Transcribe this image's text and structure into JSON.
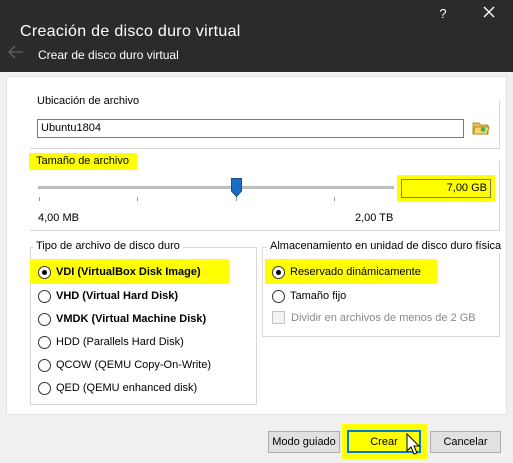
{
  "window": {
    "title": "Creación de disco duro virtual",
    "subtitle": "Crear de disco duro virtual",
    "help_label": "?"
  },
  "file_location": {
    "label": "Ubicación de archivo",
    "value": "Ubuntu1804",
    "browse_icon": "folder-icon"
  },
  "file_size": {
    "label": "Tamaño de archivo",
    "value": "7,00 GB",
    "min_label": "4,00 MB",
    "max_label": "2,00 TB",
    "slider_fraction": 0.56
  },
  "disk_type": {
    "label": "Tipo de archivo de disco duro",
    "options": [
      {
        "label": "VDI (VirtualBox Disk Image)",
        "selected": true
      },
      {
        "label": "VHD (Virtual Hard Disk)",
        "selected": false
      },
      {
        "label": "VMDK (Virtual Machine Disk)",
        "selected": false
      },
      {
        "label": "HDD (Parallels Hard Disk)",
        "selected": false
      },
      {
        "label": "QCOW (QEMU Copy-On-Write)",
        "selected": false
      },
      {
        "label": "QED (QEMU enhanced disk)",
        "selected": false
      }
    ]
  },
  "storage": {
    "label": "Almacenamiento en unidad de disco duro física",
    "options": [
      {
        "label": "Reservado dinámicamente",
        "selected": true
      },
      {
        "label": "Tamaño fijo",
        "selected": false
      }
    ],
    "split_label": "Dividir en archivos de menos de 2 GB"
  },
  "buttons": {
    "expert": "Modo guiado",
    "create": "Crear",
    "cancel": "Cancelar"
  },
  "colors": {
    "highlight": "#ffff00",
    "titlebar": "#2b2b2b",
    "slider_thumb": "#1a6fc4"
  }
}
